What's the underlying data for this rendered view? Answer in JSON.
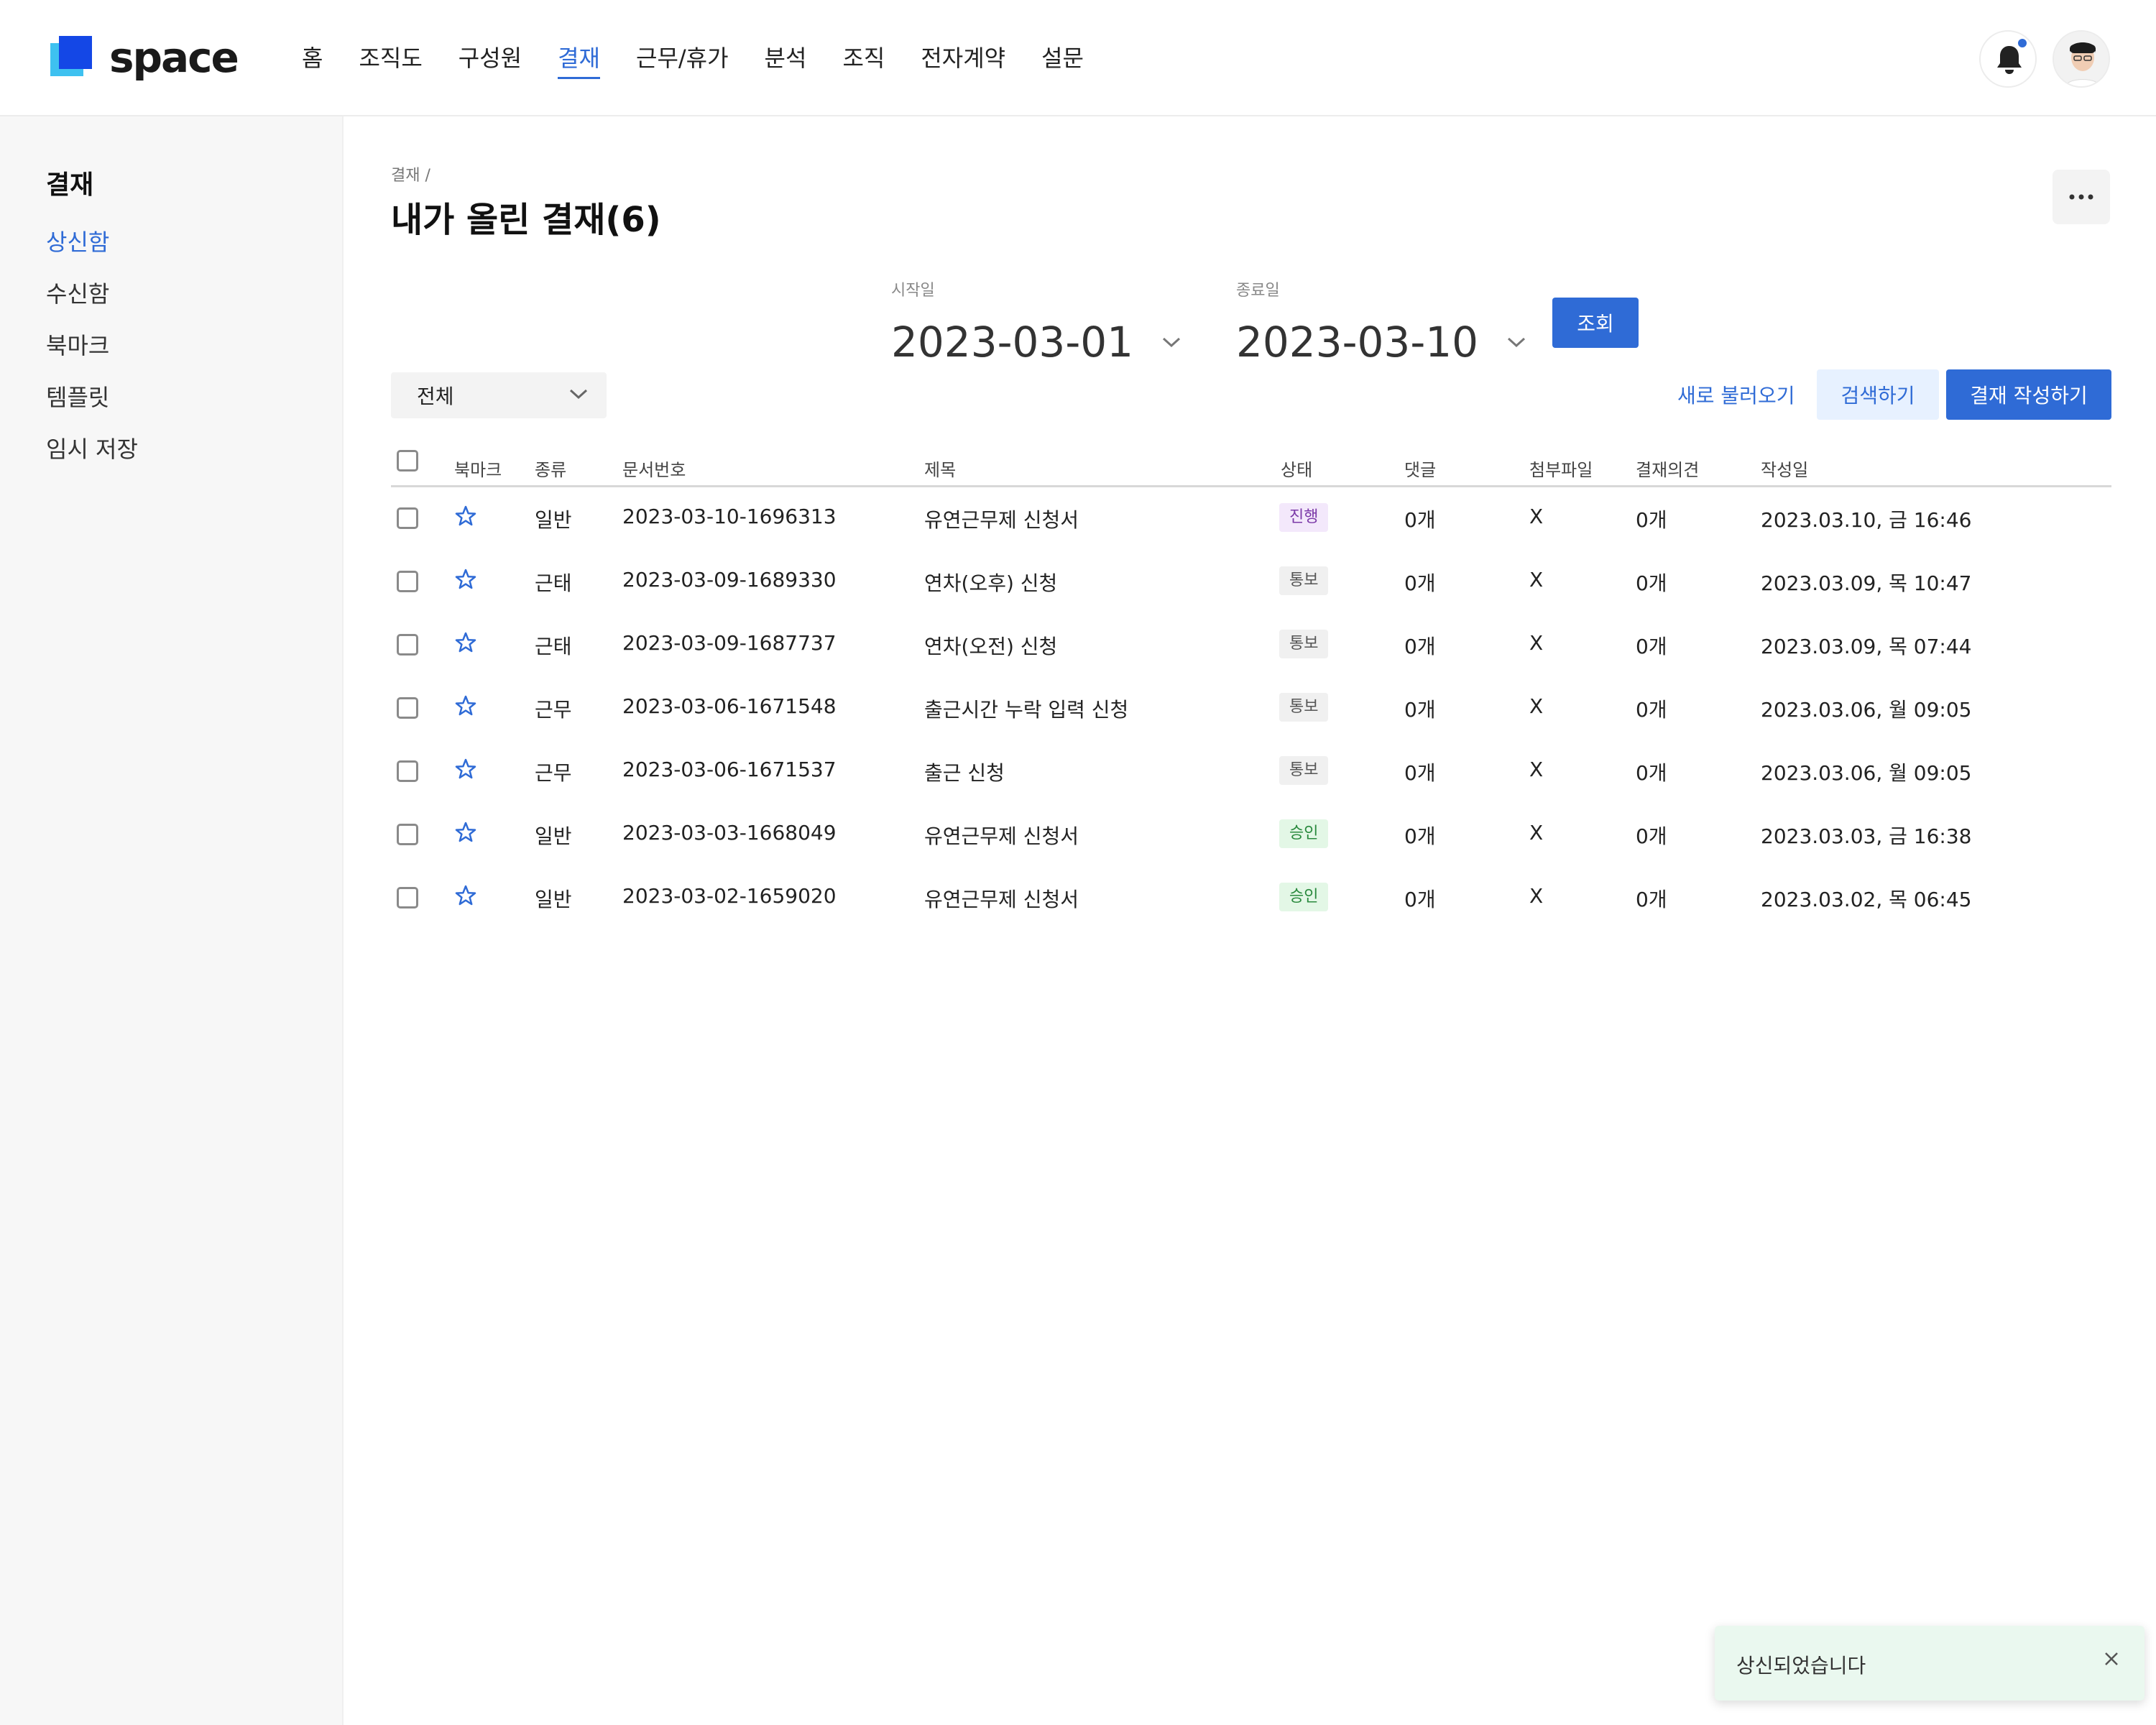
{
  "app": {
    "logo_text": "space",
    "brand_color": "#2f6bd6"
  },
  "nav": {
    "items": [
      {
        "label": "홈"
      },
      {
        "label": "조직도"
      },
      {
        "label": "구성원"
      },
      {
        "label": "결재",
        "active": true
      },
      {
        "label": "근무/휴가"
      },
      {
        "label": "분석"
      },
      {
        "label": "조직"
      },
      {
        "label": "전자계약"
      },
      {
        "label": "설문"
      }
    ],
    "bell_icon": "bell-icon",
    "has_notification": true
  },
  "sidebar": {
    "title": "결재",
    "items": [
      {
        "label": "상신함",
        "active": true
      },
      {
        "label": "수신함"
      },
      {
        "label": "북마크"
      },
      {
        "label": "템플릿"
      },
      {
        "label": "임시 저장"
      }
    ]
  },
  "main": {
    "breadcrumb": "결재 /",
    "title": "내가 올린 결재(6)",
    "more_icon": "more-icon",
    "start_date": {
      "label": "시작일",
      "value": "2023-03-01"
    },
    "end_date": {
      "label": "종료일",
      "value": "2023-03-10"
    },
    "query_button": "조회",
    "filter_select": {
      "value": "전체"
    },
    "refresh_button": "새로 불러오기",
    "search_button": "검색하기",
    "write_button": "결재 작성하기"
  },
  "table": {
    "columns": {
      "bookmark": "북마크",
      "kind": "종류",
      "doc_no": "문서번호",
      "subject": "제목",
      "status": "상태",
      "comments": "댓글",
      "attachment": "첨부파일",
      "opinion": "결재의견",
      "created": "작성일"
    },
    "rows": [
      {
        "kind": "일반",
        "doc_no": "2023-03-10-1696313",
        "subject": "유연근무제 신청서",
        "status": "진행",
        "status_type": "progress",
        "comments": "0개",
        "attachment": "X",
        "opinion": "0개",
        "created": "2023.03.10, 금 16:46"
      },
      {
        "kind": "근태",
        "doc_no": "2023-03-09-1689330",
        "subject": "연차(오후) 신청",
        "status": "통보",
        "status_type": "notice",
        "comments": "0개",
        "attachment": "X",
        "opinion": "0개",
        "created": "2023.03.09, 목 10:47"
      },
      {
        "kind": "근태",
        "doc_no": "2023-03-09-1687737",
        "subject": "연차(오전) 신청",
        "status": "통보",
        "status_type": "notice",
        "comments": "0개",
        "attachment": "X",
        "opinion": "0개",
        "created": "2023.03.09, 목 07:44"
      },
      {
        "kind": "근무",
        "doc_no": "2023-03-06-1671548",
        "subject": "출근시간 누락 입력 신청",
        "status": "통보",
        "status_type": "notice",
        "comments": "0개",
        "attachment": "X",
        "opinion": "0개",
        "created": "2023.03.06, 월 09:05"
      },
      {
        "kind": "근무",
        "doc_no": "2023-03-06-1671537",
        "subject": "출근 신청",
        "status": "통보",
        "status_type": "notice",
        "comments": "0개",
        "attachment": "X",
        "opinion": "0개",
        "created": "2023.03.06, 월 09:05"
      },
      {
        "kind": "일반",
        "doc_no": "2023-03-03-1668049",
        "subject": "유연근무제 신청서",
        "status": "승인",
        "status_type": "approve",
        "comments": "0개",
        "attachment": "X",
        "opinion": "0개",
        "created": "2023.03.03, 금 16:38"
      },
      {
        "kind": "일반",
        "doc_no": "2023-03-02-1659020",
        "subject": "유연근무제 신청서",
        "status": "승인",
        "status_type": "approve",
        "comments": "0개",
        "attachment": "X",
        "opinion": "0개",
        "created": "2023.03.02, 목 06:45"
      }
    ]
  },
  "toast": {
    "message": "상신되었습니다",
    "close_icon": "close-icon"
  }
}
